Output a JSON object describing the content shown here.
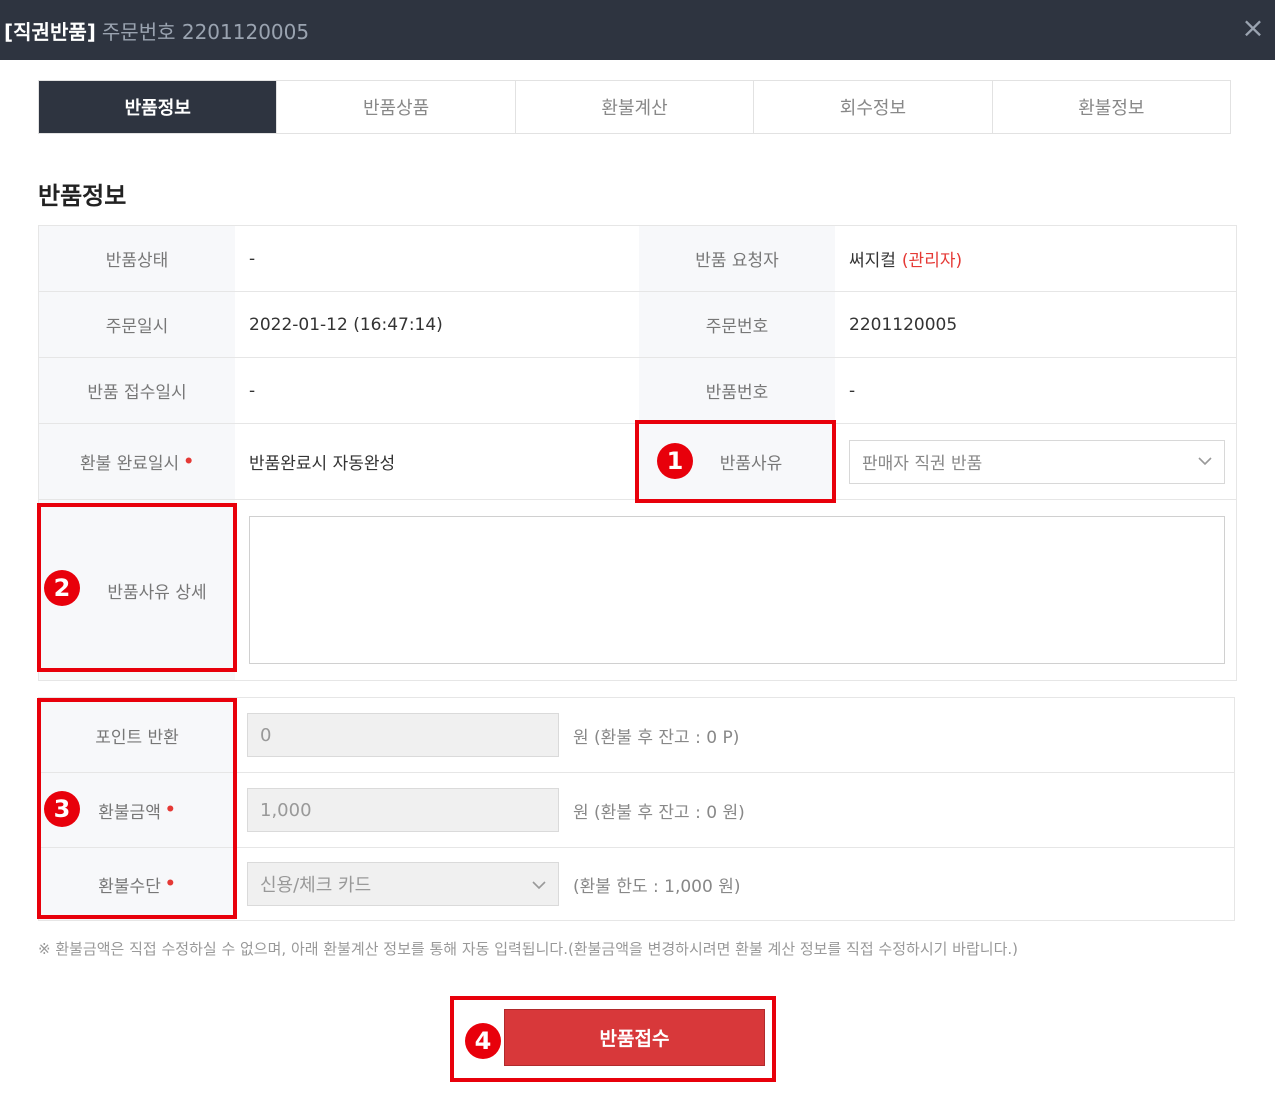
{
  "window": {
    "title": "[직권반품]",
    "subtitle": "주문번호 2201120005",
    "close_symbol": "×"
  },
  "tabs": [
    {
      "label": "반품정보",
      "active": true
    },
    {
      "label": "반품상품",
      "active": false
    },
    {
      "label": "환불계산",
      "active": false
    },
    {
      "label": "회수정보",
      "active": false
    },
    {
      "label": "환불정보",
      "active": false
    }
  ],
  "section_title": "반품정보",
  "info": {
    "return_status_label": "반품상태",
    "return_status_value": "-",
    "requester_label": "반품 요청자",
    "requester_name": "써지컬",
    "requester_role": "(관리자)",
    "order_date_label": "주문일시",
    "order_date_value": "2022-01-12 (16:47:14)",
    "order_no_label": "주문번호",
    "order_no_value": "2201120005",
    "receipt_date_label": "반품 접수일시",
    "receipt_date_value": "-",
    "return_no_label": "반품번호",
    "return_no_value": "-",
    "refund_complete_label": "환불 완료일시",
    "refund_complete_value": "반품완료시 자동완성",
    "reason_label": "반품사유",
    "reason_selected": "판매자 직권 반품",
    "reason_detail_label": "반품사유 상세",
    "reason_detail_value": ""
  },
  "refund": {
    "point_label": "포인트 반환",
    "point_value": "0",
    "point_note": "원 (환불 후 잔고 : 0 P)",
    "amount_label": "환불금액",
    "amount_value": "1,000",
    "amount_note": "원 (환불 후 잔고 : 0 원)",
    "method_label": "환불수단",
    "method_selected": "신용/체크 카드",
    "method_note": "(환불 한도 : 1,000 원)"
  },
  "required_mark": "•",
  "footnote": "※ 환불금액은 직접 수정하실 수 없으며, 아래 환불계산 정보를 통해 자동 입력됩니다.(환불금액을 변경하시려면 환불 계산 정보를 직접 수정하시기 바랍니다.)",
  "submit_label": "반품접수",
  "annotations": [
    "1",
    "2",
    "3",
    "4"
  ],
  "colors": {
    "header_bg": "#2e3440",
    "accent_red": "#d8383a",
    "annotation_red": "#e8000b"
  }
}
